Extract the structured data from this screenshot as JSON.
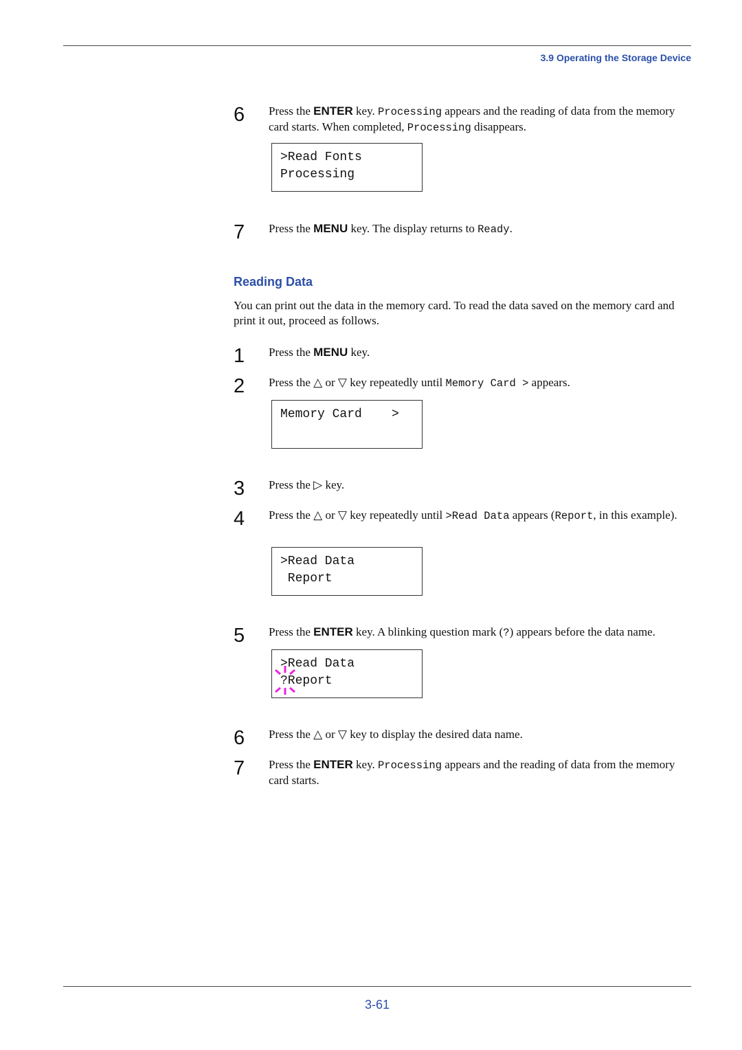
{
  "header": {
    "section": "3.9 Operating the Storage Device"
  },
  "footer": {
    "page_number": "3-61"
  },
  "content": [
    {
      "kind": "step",
      "num": "6",
      "segs": [
        [
          "n",
          "Press the "
        ],
        [
          "b",
          "ENTER"
        ],
        [
          "n",
          " key. "
        ],
        [
          "m",
          "Processing"
        ],
        [
          "n",
          " appears and the reading of data from the memory card starts. When completed, "
        ],
        [
          "m",
          "Processing"
        ],
        [
          "n",
          " disappears."
        ]
      ]
    },
    {
      "kind": "box",
      "lines": [
        ">Read Fonts",
        "Processing"
      ]
    },
    {
      "kind": "step",
      "num": "7",
      "segs": [
        [
          "n",
          "Press the "
        ],
        [
          "b",
          "MENU"
        ],
        [
          "n",
          " key. The display returns to "
        ],
        [
          "m",
          "Ready"
        ],
        [
          "n",
          "."
        ]
      ]
    },
    {
      "kind": "heading",
      "text": "Reading Data"
    },
    {
      "kind": "para",
      "text": "You can print out the data in the memory card. To read the data saved on the memory card and print it out, proceed as follows."
    },
    {
      "kind": "step",
      "num": "1",
      "segs": [
        [
          "n",
          "Press the "
        ],
        [
          "b",
          "MENU"
        ],
        [
          "n",
          " key."
        ]
      ]
    },
    {
      "kind": "step",
      "num": "2",
      "segs": [
        [
          "n",
          "Press the △ or ▽ key repeatedly until "
        ],
        [
          "m",
          "Memory Card >"
        ],
        [
          "n",
          " appears."
        ]
      ]
    },
    {
      "kind": "box",
      "lines": [
        "Memory Card    >",
        ""
      ]
    },
    {
      "kind": "step",
      "num": "3",
      "segs": [
        [
          "n",
          "Press the ▷ key."
        ]
      ]
    },
    {
      "kind": "step",
      "num": "4",
      "segs": [
        [
          "n",
          "Press the △ or ▽ key repeatedly until "
        ],
        [
          "m",
          ">Read Data"
        ],
        [
          "n",
          " appears ("
        ],
        [
          "m",
          "Report"
        ],
        [
          "n",
          ", in this example)."
        ]
      ]
    },
    {
      "kind": "box",
      "lines": [
        ">Read Data",
        " Report"
      ]
    },
    {
      "kind": "step",
      "num": "5",
      "segs": [
        [
          "n",
          "Press the "
        ],
        [
          "b",
          "ENTER"
        ],
        [
          "n",
          " key. A blinking question mark ("
        ],
        [
          "m",
          "?"
        ],
        [
          "n",
          ") appears before the data name."
        ]
      ]
    },
    {
      "kind": "box",
      "lines": [
        ">Read Data",
        "?Report"
      ],
      "blink": true,
      "blink_color": "#ee22dd"
    },
    {
      "kind": "step",
      "num": "6",
      "segs": [
        [
          "n",
          "Press the △ or ▽ key to display the desired data name."
        ]
      ]
    },
    {
      "kind": "step",
      "num": "7",
      "segs": [
        [
          "n",
          "Press the "
        ],
        [
          "b",
          "ENTER"
        ],
        [
          "n",
          " key. "
        ],
        [
          "m",
          "Processing"
        ],
        [
          "n",
          " appears and the reading of data from the memory card starts."
        ]
      ]
    }
  ]
}
